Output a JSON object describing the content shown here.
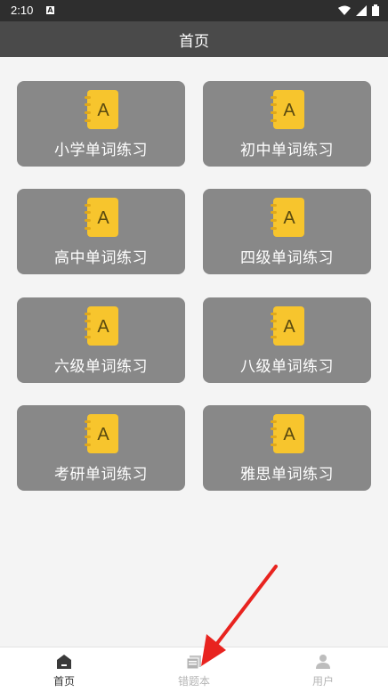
{
  "status_bar": {
    "time": "2:10",
    "notification_letter": "A"
  },
  "app_bar": {
    "title": "首页"
  },
  "cards": [
    {
      "label": "小学单词练习",
      "icon_letter": "A"
    },
    {
      "label": "初中单词练习",
      "icon_letter": "A"
    },
    {
      "label": "高中单词练习",
      "icon_letter": "A"
    },
    {
      "label": "四级单词练习",
      "icon_letter": "A"
    },
    {
      "label": "六级单词练习",
      "icon_letter": "A"
    },
    {
      "label": "八级单词练习",
      "icon_letter": "A"
    },
    {
      "label": "考研单词练习",
      "icon_letter": "A"
    },
    {
      "label": "雅思单词练习",
      "icon_letter": "A"
    }
  ],
  "bottom_nav": {
    "items": [
      {
        "label": "首页",
        "icon": "home-icon",
        "active": true
      },
      {
        "label": "错题本",
        "icon": "notebook-icon",
        "active": false
      },
      {
        "label": "用户",
        "icon": "user-icon",
        "active": false
      }
    ]
  },
  "colors": {
    "app_bar": "#4a4a4a",
    "card": "#888888",
    "icon_yellow": "#f7c52d",
    "annotation_arrow": "#e8231f"
  }
}
